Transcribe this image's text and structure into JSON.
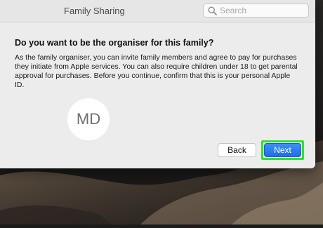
{
  "window": {
    "title": "Family Sharing",
    "search_placeholder": "Search"
  },
  "dialog": {
    "heading": "Do you want to be the organiser for this family?",
    "body": "As the family organiser, you can invite family members and agree to pay for purchases they initiate from Apple services. You can also require children under 18 to get parental approval for purchases. Before you continue, confirm that this is your personal Apple ID.",
    "avatar_initials": "MD",
    "back_label": "Back",
    "next_label": "Next"
  },
  "colors": {
    "accent": "#2f7ff0",
    "highlight": "#2ee32e"
  }
}
